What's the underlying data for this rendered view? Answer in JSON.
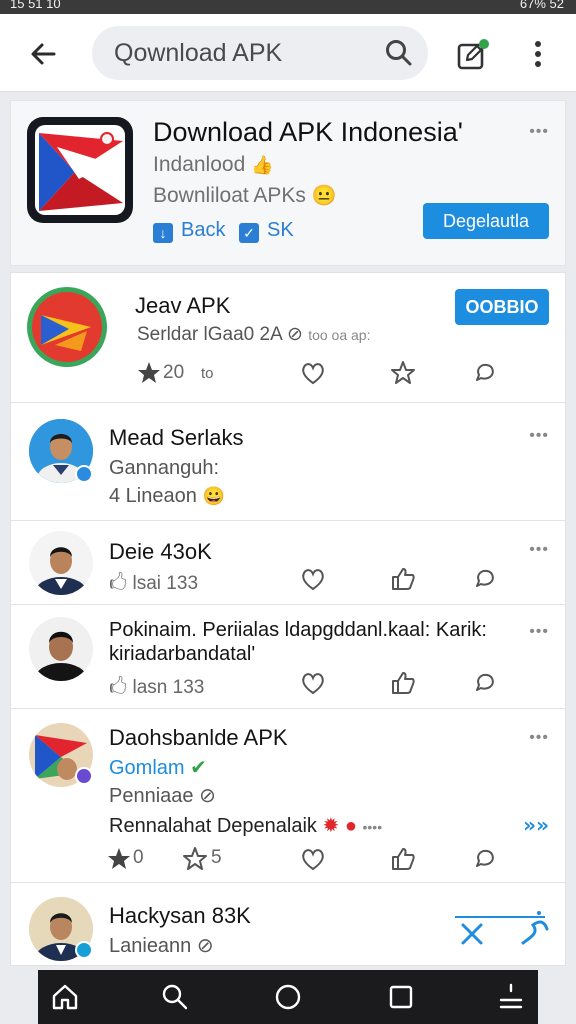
{
  "status": {
    "left": "15 51 10",
    "right": "67% 52"
  },
  "search": {
    "query": "Qownload APK"
  },
  "app": {
    "title": "Download APK Indonesia'",
    "subtitle1": "Indanlood",
    "subtitle2": "Bownliloat APKs",
    "tag1": "Back",
    "tag2": "SK",
    "download_label": "Degelautla"
  },
  "posts": [
    {
      "name": "Jeav APK",
      "line1": "Serldar lGaa0 2A",
      "line1_suffix": "too oa ap:",
      "stars": "20",
      "stars_unit": "to",
      "button": "OOBBIO"
    },
    {
      "name": "Mead Serlaks",
      "line1": "Gannanguh:",
      "line2": "4 Lineaon"
    },
    {
      "name": "Deie 43oK",
      "meta": "lsai 133"
    },
    {
      "name": "Pokinaim. Periialas ldapgddanl.kaal: Karik:",
      "name2": "kiriadarbandatal'",
      "meta": "lasn 133"
    },
    {
      "name": "Daohsbanlde APK",
      "line1": "Gomlam",
      "line2": "Penniaae",
      "line3": "Rennalahat Depenalaik",
      "stat1": "0",
      "stat2": "5"
    },
    {
      "name": "Hackysan 83K",
      "line1": "Lanieann"
    }
  ],
  "colors": {
    "accent": "#1d8de0",
    "link": "#2a7fd4",
    "badge_green": "#2fa34a",
    "badge_red": "#e0272b"
  }
}
